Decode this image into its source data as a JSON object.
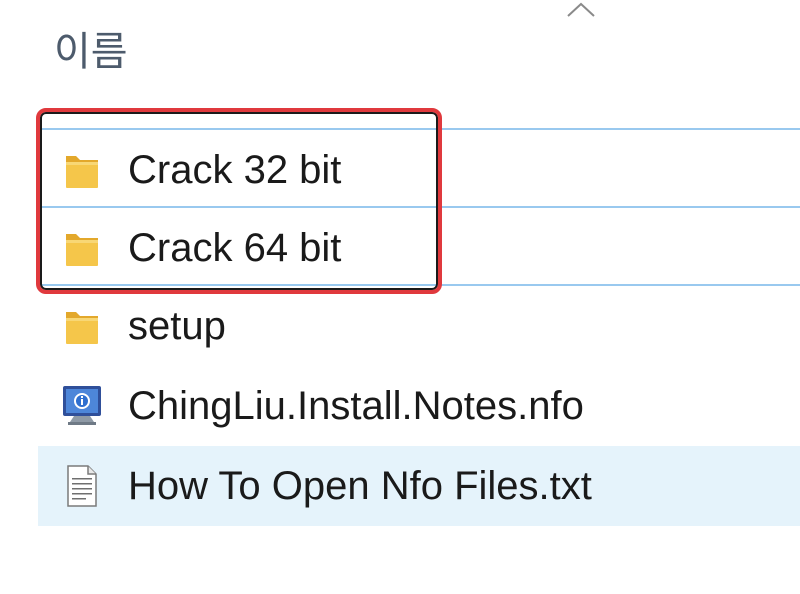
{
  "header": {
    "column_name": "이름",
    "sort_direction": "ascending"
  },
  "files": [
    {
      "name": "Crack 32 bit",
      "type": "folder",
      "icon": "folder-icon"
    },
    {
      "name": "Crack 64 bit",
      "type": "folder",
      "icon": "folder-icon"
    },
    {
      "name": "setup",
      "type": "folder",
      "icon": "folder-icon"
    },
    {
      "name": "ChingLiu.Install.Notes.nfo",
      "type": "nfo",
      "icon": "nfo-file-icon"
    },
    {
      "name": "How To Open Nfo Files.txt",
      "type": "txt",
      "icon": "text-file-icon"
    }
  ],
  "colors": {
    "folder": "#f5c64a",
    "selection_border": "#99c9ef",
    "hover_background": "#e5f3fb",
    "annotation": "#e0393d",
    "header_text": "#4d5b6c"
  }
}
